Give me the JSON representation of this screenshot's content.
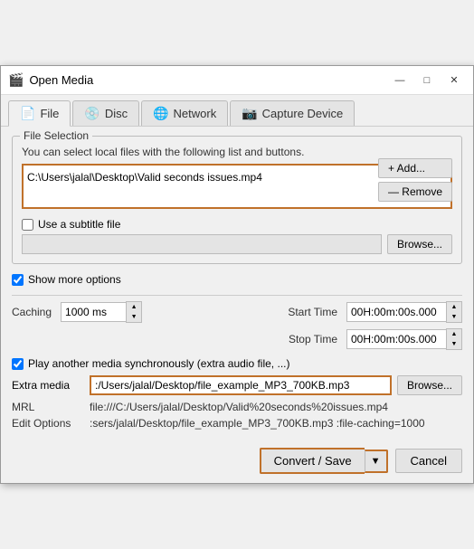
{
  "window": {
    "title": "Open Media",
    "icon": "🎬"
  },
  "titlebar": {
    "minimize_label": "—",
    "maximize_label": "□",
    "close_label": "✕"
  },
  "tabs": [
    {
      "id": "file",
      "label": "File",
      "icon": "📄",
      "active": true
    },
    {
      "id": "disc",
      "label": "Disc",
      "icon": "💿",
      "active": false
    },
    {
      "id": "network",
      "label": "Network",
      "icon": "🌐",
      "active": false
    },
    {
      "id": "capture",
      "label": "Capture Device",
      "icon": "📷",
      "active": false
    }
  ],
  "file_selection": {
    "group_title": "File Selection",
    "description": "You can select local files with the following list and buttons.",
    "file_path": "C:\\Users\\jalal\\Desktop\\Valid seconds issues.mp4",
    "add_button": "+ Add...",
    "remove_button": "— Remove",
    "subtitle": {
      "label": "Use a subtitle file",
      "placeholder": "",
      "browse_button": "Browse..."
    }
  },
  "show_more": {
    "label": "Show more options",
    "checked": true
  },
  "options": {
    "caching_label": "Caching",
    "caching_value": "1000 ms",
    "start_time_label": "Start Time",
    "start_time_value": "00H:00m:00s.000",
    "stop_time_label": "Stop Time",
    "stop_time_value": "00H:00m:00s.000"
  },
  "sync": {
    "label": "Play another media synchronously (extra audio file, ...)",
    "checked": true
  },
  "extra_media": {
    "label": "Extra media",
    "value": ":/Users/jalal/Desktop/file_example_MP3_700KB.mp3",
    "browse_button": "Browse..."
  },
  "mrl": {
    "label": "MRL",
    "value": "file:///C:/Users/jalal/Desktop/Valid%20seconds%20issues.mp4"
  },
  "edit_options": {
    "label": "Edit Options",
    "value": ":sers/jalal/Desktop/file_example_MP3_700KB.mp3 :file-caching=1000"
  },
  "bottom": {
    "convert_save_label": "Convert / Save",
    "cancel_label": "Cancel"
  }
}
